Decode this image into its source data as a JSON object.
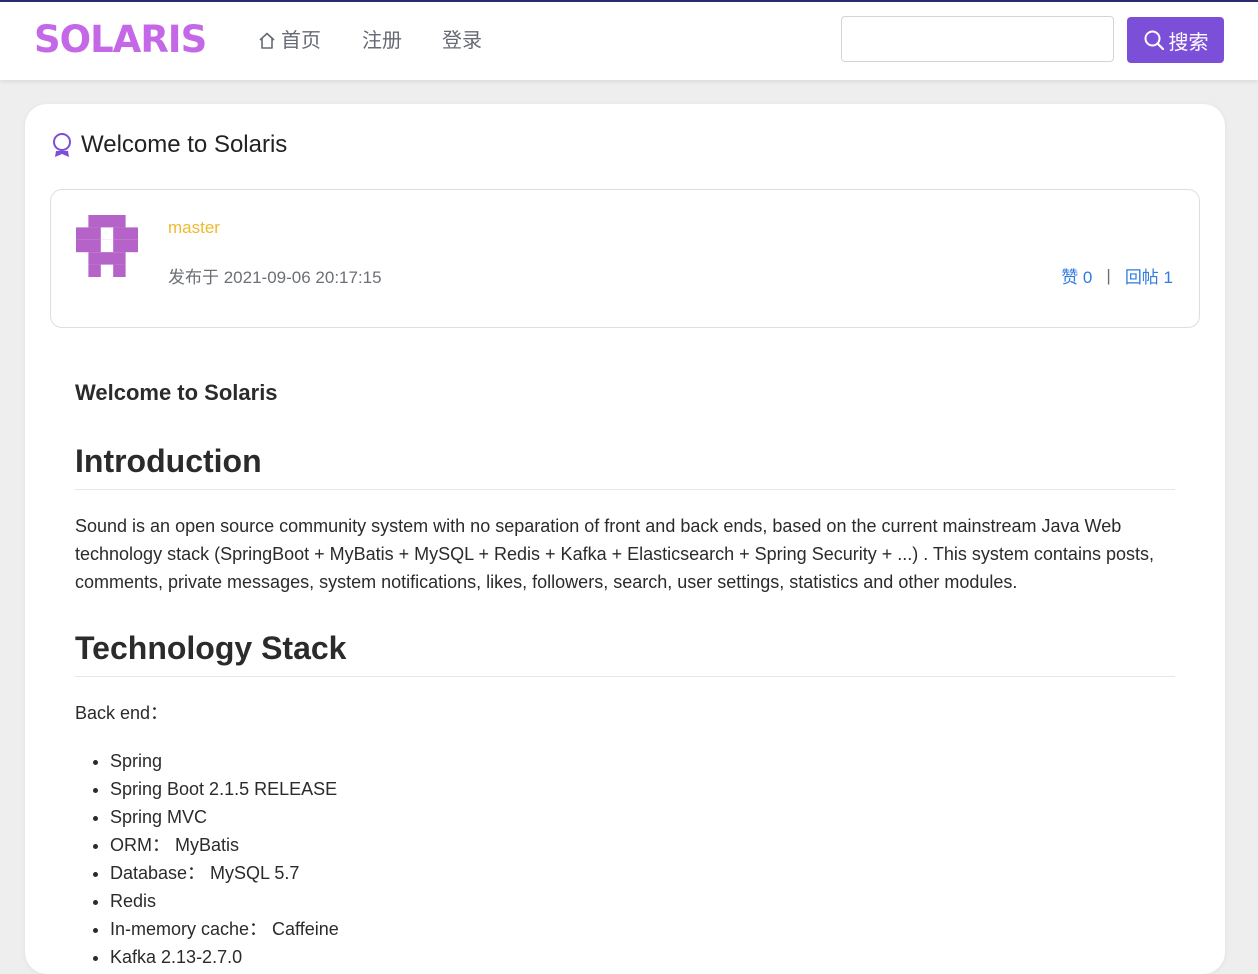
{
  "navbar": {
    "logo": "SOLARIS",
    "nav_items": [
      {
        "label": "首页",
        "icon": "home-icon"
      },
      {
        "label": "注册"
      },
      {
        "label": "登录"
      }
    ],
    "search_placeholder": "",
    "search_button": "搜索",
    "accent_color": "#7b4fd8",
    "logo_color": "#c468e8"
  },
  "post": {
    "title": "Welcome to Solaris",
    "author": "master",
    "published": "发布于 2021-09-06 20:17:15",
    "likes": "赞 0",
    "separator": "|",
    "replies": "回帖 1",
    "content": {
      "lead": "Welcome to Solaris",
      "h_intro": "Introduction",
      "intro": "Sound is an open source community system with no separation of front and back ends, based on the current mainstream Java Web technology stack (SpringBoot + MyBatis + MySQL + Redis + Kafka + Elasticsearch + Spring Security + ...) . This system contains posts, comments, private messages, system notifications, likes, followers, search, user settings, statistics and other modules.",
      "h_stack": "Technology Stack",
      "backend_label": "Back end：",
      "backend_items": [
        "Spring",
        "Spring Boot 2.1.5 RELEASE",
        "Spring MVC",
        "ORM： MyBatis",
        "Database： MySQL 5.7",
        "Redis",
        "In-memory cache： Caffeine",
        "Kafka 2.13-2.7.0"
      ]
    }
  }
}
